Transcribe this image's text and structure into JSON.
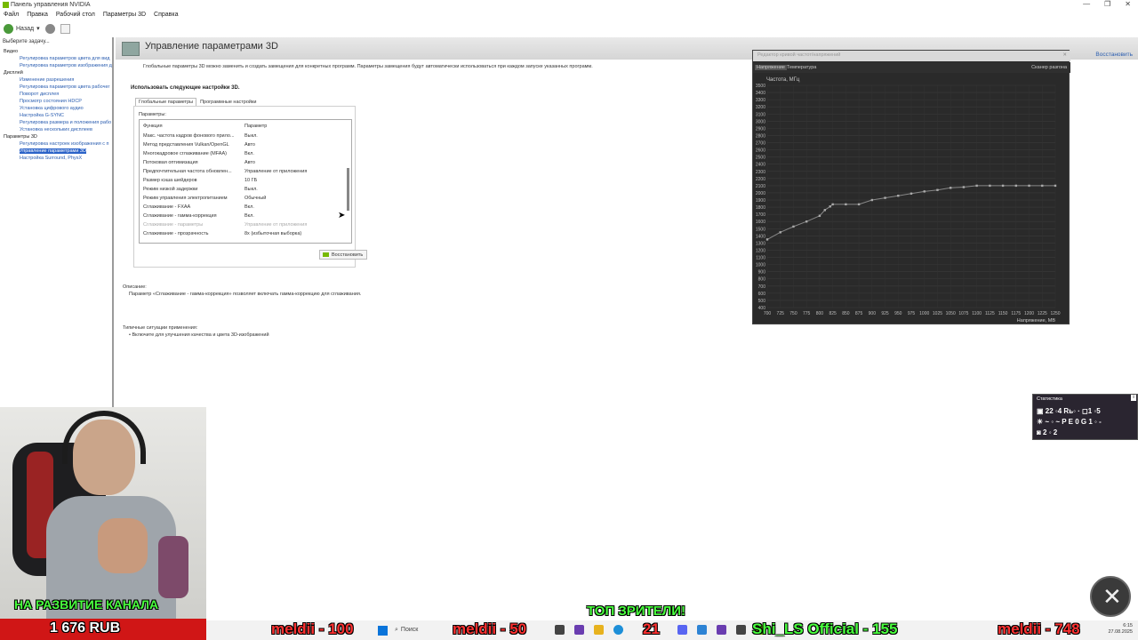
{
  "window": {
    "title": "Панель управления NVIDIA",
    "controls": [
      "—",
      "❐",
      "✕"
    ]
  },
  "menu": [
    "Файл",
    "Правка",
    "Рабочий стол",
    "Параметры 3D",
    "Справка"
  ],
  "toolbar": {
    "back_label": "Назад"
  },
  "sidebar": {
    "header": "Выберите задачу...",
    "items": [
      {
        "label": "Видео",
        "type": "cat"
      },
      {
        "label": "Регулировка параметров цвета для вид",
        "type": "sub"
      },
      {
        "label": "Регулировка параметров изображения д",
        "type": "sub"
      },
      {
        "label": "Дисплей",
        "type": "cat"
      },
      {
        "label": "Изменение разрешения",
        "type": "sub"
      },
      {
        "label": "Регулировка параметров цвета рабочег",
        "type": "sub"
      },
      {
        "label": "Поворот дисплея",
        "type": "sub"
      },
      {
        "label": "Просмотр состояния HDCP",
        "type": "sub"
      },
      {
        "label": "Установка цифрового аудио",
        "type": "sub"
      },
      {
        "label": "Настройка G-SYNC",
        "type": "sub"
      },
      {
        "label": "Регулировка размера и положения рабо",
        "type": "sub"
      },
      {
        "label": "Установка нескольких дисплеев",
        "type": "sub"
      },
      {
        "label": "Параметры 3D",
        "type": "cat"
      },
      {
        "label": "Регулировка настроек изображения с п",
        "type": "sub"
      },
      {
        "label": "Управление параметрами 3D",
        "type": "sub selected"
      },
      {
        "label": "Настройка Surround, PhysX",
        "type": "sub"
      }
    ]
  },
  "main": {
    "title": "Управление параметрами 3D",
    "restore_defaults": "Восстановить",
    "intro": "Глобальные параметры 3D можно заменить и создать замещения для конкретных программ. Параметры замещения будут автоматически использоваться при каждом запуске указанных программ.",
    "use_settings": "Использовать следующие настройки 3D.",
    "tabs": [
      "Глобальные параметры",
      "Программные настройки"
    ],
    "params_label": "Параметры:",
    "table_header": {
      "function": "Функция",
      "param": "Параметр"
    },
    "settings": [
      {
        "f": "Макс. частота кадров фонового прило...",
        "v": "Выкл."
      },
      {
        "f": "Метод представления Vulkan/OpenGL",
        "v": "Авто"
      },
      {
        "f": "Многокадровое сглаживание (MFAA)",
        "v": "Вкл."
      },
      {
        "f": "Потоковая оптимизация",
        "v": "Авто"
      },
      {
        "f": "Предпочтительная частота обновлен...",
        "v": "Управление от приложения"
      },
      {
        "f": "Размер кэша шейдеров",
        "v": "10 ГБ"
      },
      {
        "f": "Режим низкой задержки",
        "v": "Выкл."
      },
      {
        "f": "Режим управления электропитанием",
        "v": "Обычный"
      },
      {
        "f": "Сглаживание - FXAA",
        "v": "Вкл."
      },
      {
        "f": "Сглаживание - гамма-коррекция",
        "v": "Вкл."
      },
      {
        "f": "Сглаживание - параметры",
        "v": "Управление от приложения",
        "dim": true
      },
      {
        "f": "Сглаживание - прозрачность",
        "v": "8x (избыточная выборка)"
      }
    ],
    "restore_button": "Восстановить",
    "desc_heading": "Описание:",
    "desc_text": "Параметр «Сглаживание - гамма-коррекция» позволяет включать гамма-коррекцию для сглаживания.",
    "usage_heading": "Типичные ситуации применения:",
    "usage_item": "• Включите для улучшения качества и цвета 3D-изображений"
  },
  "curve_editor": {
    "title": "Редактор кривой частот/напряжений",
    "tabs": [
      "Напряжение",
      "Температура"
    ],
    "scanner": "Сканер разгона"
  },
  "chart_data": {
    "type": "line",
    "ylabel": "Частота, МГц",
    "xlabel": "Напряжение, МВ",
    "x_ticks": [
      700,
      725,
      750,
      775,
      800,
      825,
      850,
      875,
      900,
      925,
      950,
      975,
      1000,
      1025,
      1050,
      1075,
      1100,
      1125,
      1150,
      1175,
      1200,
      1225,
      1250
    ],
    "y_ticks": [
      3500,
      3400,
      3300,
      3200,
      3100,
      3000,
      2900,
      2800,
      2700,
      2600,
      2500,
      2400,
      2300,
      2200,
      2100,
      2000,
      1900,
      1800,
      1700,
      1600,
      1500,
      1400,
      1300,
      1200,
      1100,
      1000,
      900,
      800,
      700,
      600,
      500,
      400
    ],
    "xlim": [
      700,
      1250
    ],
    "ylim": [
      400,
      3500
    ],
    "x": [
      700,
      725,
      750,
      775,
      800,
      810,
      820,
      825,
      850,
      875,
      900,
      925,
      950,
      975,
      1000,
      1025,
      1050,
      1075,
      1100,
      1125,
      1150,
      1175,
      1200,
      1225,
      1250
    ],
    "y": [
      1350,
      1450,
      1530,
      1600,
      1680,
      1760,
      1810,
      1840,
      1840,
      1840,
      1900,
      1930,
      1960,
      1990,
      2020,
      2040,
      2070,
      2080,
      2100,
      2100,
      2100,
      2100,
      2100,
      2100,
      2100
    ],
    "grid": true
  },
  "stats": {
    "title": "Статистика",
    "line1": "▣ 22 ◦4  Rь◦ · ◻1 ◦5",
    "line2": "☀ ~ ◦ ~ P E 0  G 1 ◦ -",
    "line3": "◙ 2 ◦ 2"
  },
  "stream": {
    "channel_caption": "НА РАЗВИТИЕ КАНАЛА",
    "rub": "1 676 RUB",
    "top_viewers": "ТОП ЗРИТЕЛИ!",
    "tickers": [
      {
        "text": "meldii - 100",
        "color": "red"
      },
      {
        "text": "meldii - 50",
        "color": "red"
      },
      {
        "text": "21",
        "color": "red"
      },
      {
        "text": "Shi_LS Official - 155",
        "color": "green"
      },
      {
        "text": "meldii - 748",
        "color": "red"
      }
    ]
  },
  "taskbar": {
    "search": "Поиск",
    "time": "6:15",
    "date": "27.08.2025"
  }
}
